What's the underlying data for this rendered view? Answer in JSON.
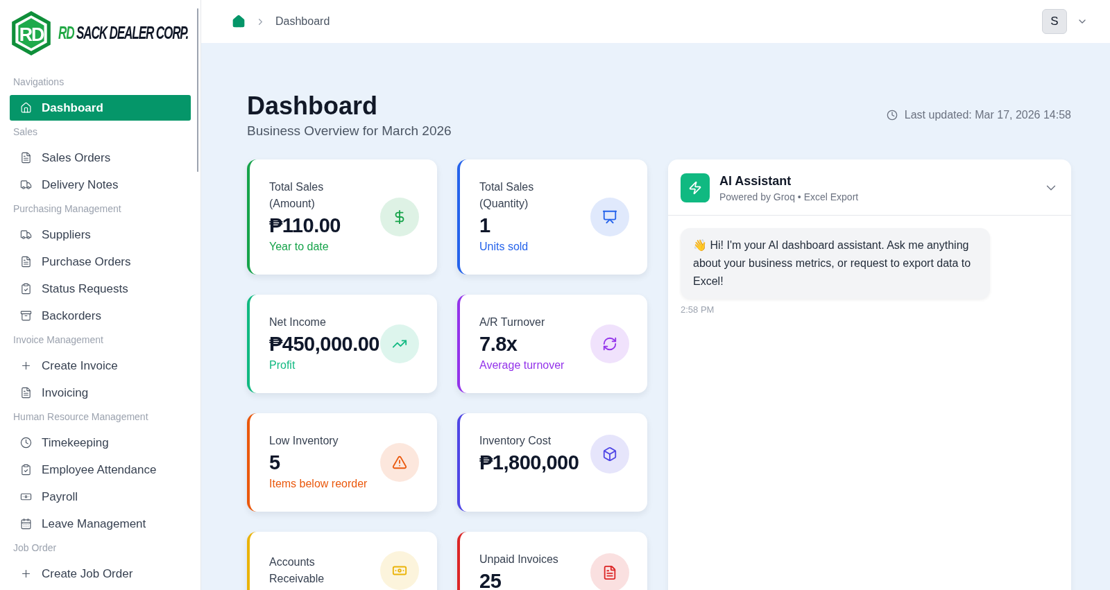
{
  "logo": {
    "mark": "RD",
    "prefix": "RD",
    "name": "SACK DEALER CORP."
  },
  "sidebar": {
    "sections": [
      {
        "label": "Navigations",
        "items": [
          {
            "label": "Dashboard",
            "kind": "home",
            "selected": true
          }
        ]
      },
      {
        "label": "Sales",
        "items": [
          {
            "label": "Sales Orders",
            "kind": "file",
            "selected": false
          },
          {
            "label": "Delivery Notes",
            "kind": "truck",
            "selected": false
          }
        ]
      },
      {
        "label": "Purchasing Management",
        "items": [
          {
            "label": "Suppliers",
            "kind": "truck",
            "selected": false
          },
          {
            "label": "Purchase Orders",
            "kind": "file",
            "selected": false
          },
          {
            "label": "Status Requests",
            "kind": "clipboard",
            "selected": false
          },
          {
            "label": "Backorders",
            "kind": "archive",
            "selected": false
          }
        ]
      },
      {
        "label": "Invoice Management",
        "items": [
          {
            "label": "Create Invoice",
            "kind": "plus",
            "selected": false
          },
          {
            "label": "Invoicing",
            "kind": "file",
            "selected": false
          }
        ]
      },
      {
        "label": "Human Resource Management",
        "items": [
          {
            "label": "Timekeeping",
            "kind": "clock",
            "selected": false
          },
          {
            "label": "Employee Attendance",
            "kind": "clipboard",
            "selected": false
          },
          {
            "label": "Payroll",
            "kind": "money",
            "selected": false
          },
          {
            "label": "Leave Management",
            "kind": "calendar",
            "selected": false
          }
        ]
      },
      {
        "label": "Job Order",
        "items": [
          {
            "label": "Create Job Order",
            "kind": "plus",
            "selected": false
          }
        ]
      }
    ]
  },
  "breadcrumb": {
    "current": "Dashboard"
  },
  "user": {
    "initial": "S"
  },
  "page": {
    "title": "Dashboard",
    "subtitle": "Business Overview for March 2026",
    "last_updated": "Last updated: Mar 17, 2026 14:58"
  },
  "cards": [
    {
      "title": "Total Sales (Amount)",
      "value": "₱110.00",
      "note": "Year to date",
      "color": "#16a34a",
      "kind": "dollar"
    },
    {
      "title": "Total Sales (Quantity)",
      "value": "1",
      "note": "Units sold",
      "color": "#2563eb",
      "kind": "presentation"
    },
    {
      "title": "Net Income",
      "value": "₱450,000.00",
      "note": "Profit",
      "color": "#10b981",
      "kind": "trend"
    },
    {
      "title": "A/R Turnover",
      "value": "7.8x",
      "note": "Average turnover",
      "color": "#9333ea",
      "kind": "refresh"
    },
    {
      "title": "Low Inventory",
      "value": "5",
      "note": "Items below reorder",
      "color": "#ea580c",
      "kind": "alert"
    },
    {
      "title": "Inventory Cost",
      "value": "₱1,800,000",
      "color": "#4f46e5",
      "kind": "box"
    },
    {
      "title": "Accounts Receivable",
      "color": "#eab308",
      "kind": "money"
    },
    {
      "title": "Unpaid Invoices",
      "value": "25",
      "color": "#dc2626",
      "kind": "file"
    }
  ],
  "assistant": {
    "title": "AI Assistant",
    "subtitle": "Powered by Groq • Excel Export",
    "expanded": true,
    "messages": [
      {
        "text": "👋 Hi! I'm your AI dashboard assistant. Ask me anything about your business metrics, or request to export data to Excel!",
        "time": "2:58 PM"
      }
    ]
  }
}
